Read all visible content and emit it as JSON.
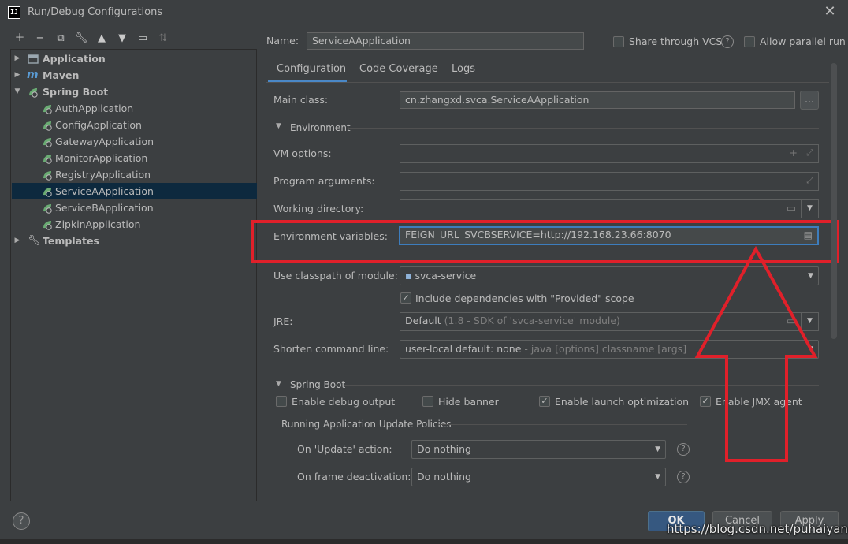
{
  "window": {
    "title": "Run/Debug Configurations",
    "app_icon_text": "IJ"
  },
  "toolbar": {
    "icons": [
      "add-icon",
      "remove-icon",
      "copy-icon",
      "wrench-icon",
      "move-up-icon",
      "move-down-icon",
      "folder-icon",
      "sort-icon"
    ]
  },
  "tree": {
    "application": "Application",
    "maven": "Maven",
    "spring_boot": "Spring Boot",
    "children": [
      "AuthApplication",
      "ConfigApplication",
      "GatewayApplication",
      "MonitorApplication",
      "RegistryApplication",
      "ServiceAApplication",
      "ServiceBApplication",
      "ZipkinApplication"
    ],
    "templates": "Templates",
    "selected": "ServiceAApplication"
  },
  "header": {
    "name_label": "Name:",
    "name_value": "ServiceAApplication",
    "share_label": "Share through VCS",
    "parallel_label": "Allow parallel run"
  },
  "tabs": {
    "configuration": "Configuration",
    "code_coverage": "Code Coverage",
    "logs": "Logs"
  },
  "form": {
    "main_class_label": "Main class:",
    "main_class_value": "cn.zhangxd.svca.ServiceAApplication",
    "browse_button": "...",
    "environment_section": "Environment",
    "vm_options_label": "VM options:",
    "program_args_label": "Program arguments:",
    "working_dir_label": "Working directory:",
    "env_vars_label": "Environment variables:",
    "env_vars_value": "FEIGN_URL_SVCBSERVICE=http://192.168.23.66:8070",
    "classpath_label": "Use classpath of module:",
    "classpath_value": "svca-service",
    "include_deps_label": "Include dependencies with \"Provided\" scope",
    "jre_label": "JRE:",
    "jre_value": "Default",
    "jre_hint": "(1.8 - SDK of 'svca-service' module)",
    "shorten_label": "Shorten command line:",
    "shorten_value": "user-local default: none",
    "shorten_hint": "- java [options] classname [args]"
  },
  "spring_boot": {
    "section": "Spring Boot",
    "debug_output": "Enable debug output",
    "hide_banner": "Hide banner",
    "launch_opt": "Enable launch optimization",
    "jmx_agent": "Enable JMX agent",
    "policies_title": "Running Application Update Policies",
    "update_label": "On 'Update' action:",
    "update_value": "Do nothing",
    "frame_label": "On frame deactivation:",
    "frame_value": "Do nothing"
  },
  "buttons": {
    "help": "?",
    "ok": "OK",
    "cancel": "Cancel",
    "apply": "Apply"
  },
  "watermark": "https://blog.csdn.net/puhaiyang",
  "colors": {
    "background": "#3c3f41",
    "selection": "#0d293e",
    "annotation_red": "#e0202a",
    "ok_button": "#365880",
    "spring_green": "#6aab73"
  }
}
